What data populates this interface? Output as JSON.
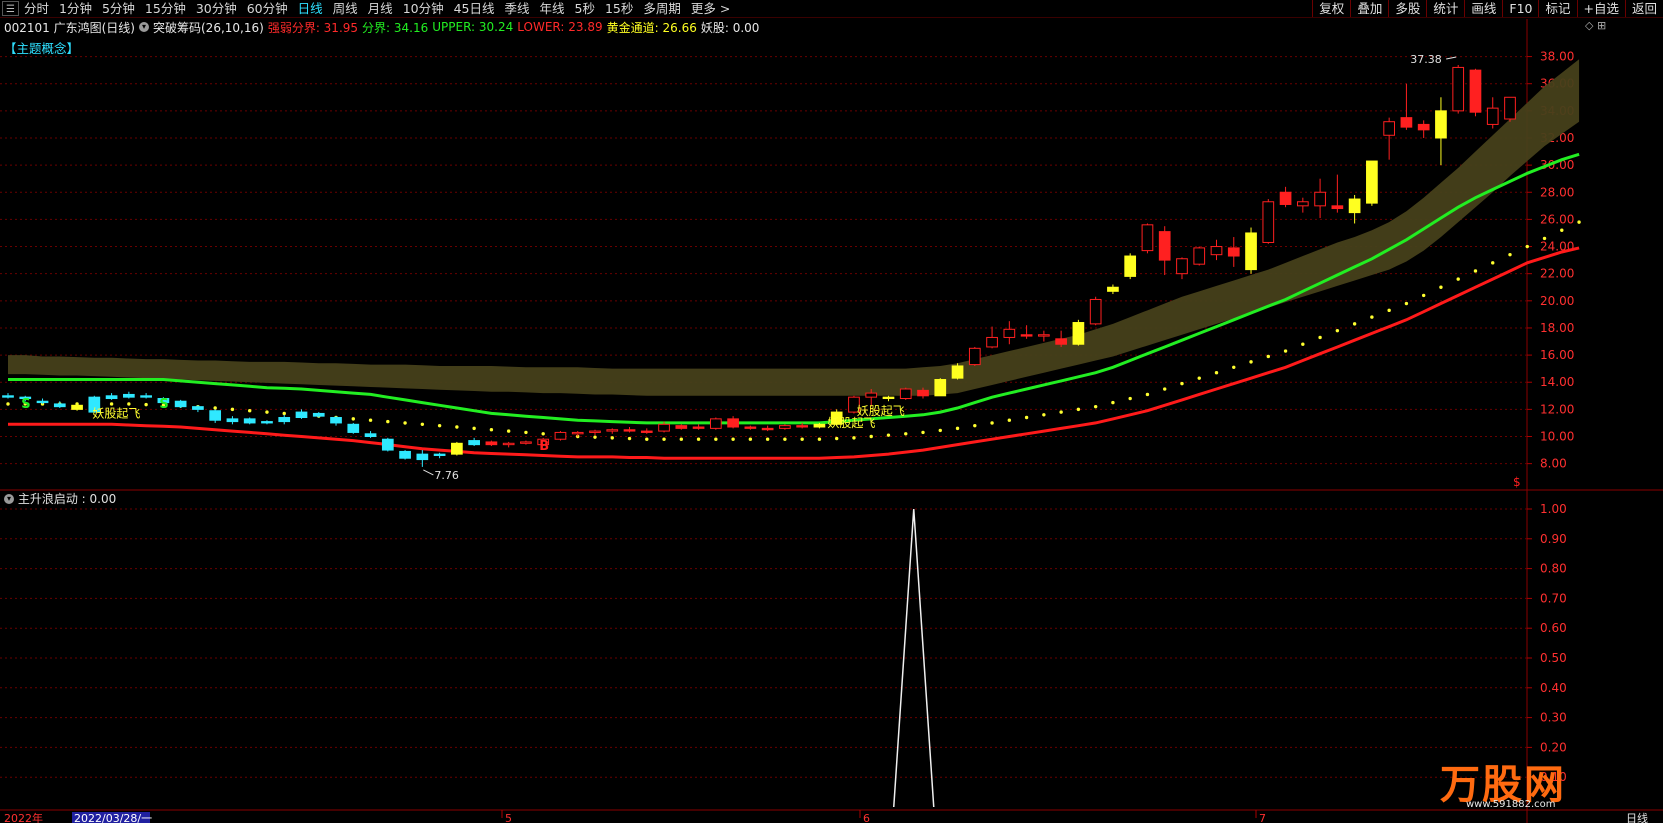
{
  "toolbar": {
    "menu_icon": "☰",
    "periods": [
      "分时",
      "1分钟",
      "5分钟",
      "15分钟",
      "30分钟",
      "60分钟",
      "日线",
      "周线",
      "月线",
      "10分钟",
      "45日线",
      "季线",
      "年线",
      "5秒",
      "15秒",
      "多周期",
      "更多 >"
    ],
    "active_period": "日线",
    "right_buttons": [
      "复权",
      "叠加",
      "多股",
      "统计",
      "画线",
      "F10",
      "标记",
      "+自选",
      "返回"
    ]
  },
  "info": {
    "code_name": "002101 广东鸿图(日线)",
    "indicator": "突破筹码(26,10,16)",
    "items": [
      {
        "label": "强弱分界: 31.95",
        "color": "#ff2a2a"
      },
      {
        "label": "分界: 34.16",
        "color": "#22ee22"
      },
      {
        "label": "UPPER: 30.24",
        "color": "#22ee22"
      },
      {
        "label": "LOWER: 23.89",
        "color": "#ff2a2a"
      },
      {
        "label": "黄金通道: 26.66",
        "color": "#ffff22"
      },
      {
        "label": "妖股: 0.00",
        "color": "#e8e8e8"
      }
    ]
  },
  "concept_label": "【主题概念】",
  "top_right_icons": "◇ ⊞",
  "main_axis": {
    "ticks": [
      "38.00",
      "36.00",
      "34.00",
      "32.00",
      "30.00",
      "28.00",
      "26.00",
      "24.00",
      "22.00",
      "20.00",
      "18.00",
      "16.00",
      "14.00",
      "12.00",
      "10.00",
      "8.00"
    ],
    "values": [
      38,
      36,
      34,
      32,
      30,
      28,
      26,
      24,
      22,
      20,
      18,
      16,
      14,
      12,
      10,
      8
    ],
    "ymin": 6.5,
    "ymax": 39
  },
  "sub_axis": {
    "ticks": [
      "1.00",
      "0.90",
      "0.80",
      "0.70",
      "0.60",
      "0.50",
      "0.40",
      "0.30",
      "0.20",
      "0.10"
    ],
    "values": [
      1,
      0.9,
      0.8,
      0.7,
      0.6,
      0.5,
      0.4,
      0.3,
      0.2,
      0.1
    ]
  },
  "sub_label": "主升浪启动 : 0.00",
  "annotations": {
    "high": "37.38",
    "low": "7.76",
    "signal1": "妖股起飞",
    "signal2": "妖股起飞",
    "signal3": "妖股起飞",
    "mark_s1": "S",
    "mark_s2": "S",
    "mark_b": "B",
    "mark_dollar": "$"
  },
  "dates": {
    "year": "2022年",
    "cursor": "2022/03/28/一",
    "m5": "5",
    "m6": "6",
    "m7": "7",
    "period": "日线"
  },
  "logo": {
    "text": "万股网",
    "url": "www.591882.com"
  },
  "chart_data": [
    {
      "type": "candlestick",
      "title": "",
      "candles": [
        [
          13.0,
          13.2,
          12.8,
          12.9
        ],
        [
          12.9,
          13.0,
          12.6,
          12.8
        ],
        [
          12.6,
          12.8,
          12.4,
          12.5
        ],
        [
          12.4,
          12.6,
          12.1,
          12.2
        ],
        [
          12.0,
          12.5,
          11.9,
          12.3
        ],
        [
          11.8,
          13.0,
          11.8,
          12.9
        ],
        [
          12.8,
          13.2,
          12.7,
          13.0
        ],
        [
          12.9,
          13.3,
          12.8,
          13.1
        ],
        [
          13.0,
          13.2,
          12.8,
          12.9
        ],
        [
          12.8,
          12.9,
          12.4,
          12.5
        ],
        [
          12.6,
          12.7,
          12.1,
          12.2
        ],
        [
          12.2,
          12.3,
          11.8,
          12.0
        ],
        [
          11.9,
          12.0,
          11.0,
          11.2
        ],
        [
          11.1,
          11.5,
          10.9,
          11.3
        ],
        [
          11.3,
          11.4,
          10.9,
          11.0
        ],
        [
          11.0,
          11.2,
          10.9,
          11.1
        ],
        [
          11.1,
          11.6,
          10.9,
          11.4
        ],
        [
          11.4,
          12.0,
          11.3,
          11.8
        ],
        [
          11.7,
          11.8,
          11.4,
          11.5
        ],
        [
          11.4,
          11.5,
          10.8,
          11.0
        ],
        [
          10.9,
          11.0,
          10.2,
          10.3
        ],
        [
          10.2,
          10.4,
          9.9,
          10.0
        ],
        [
          9.8,
          9.9,
          8.9,
          9.0
        ],
        [
          8.9,
          9.0,
          8.3,
          8.4
        ],
        [
          8.3,
          9.0,
          7.76,
          8.7
        ],
        [
          8.6,
          8.8,
          8.4,
          8.7
        ],
        [
          8.7,
          9.6,
          8.6,
          9.5
        ],
        [
          9.4,
          9.9,
          9.3,
          9.7
        ],
        [
          9.6,
          9.7,
          9.3,
          9.4
        ],
        [
          9.4,
          9.6,
          9.2,
          9.5
        ],
        [
          9.5,
          9.7,
          9.4,
          9.6
        ],
        [
          9.4,
          9.9,
          9.3,
          9.8
        ],
        [
          9.8,
          10.4,
          9.7,
          10.3
        ],
        [
          10.2,
          10.4,
          10.0,
          10.3
        ],
        [
          10.3,
          10.5,
          10.1,
          10.4
        ],
        [
          10.4,
          10.6,
          10.2,
          10.5
        ],
        [
          10.5,
          10.7,
          10.3,
          10.4
        ],
        [
          10.4,
          10.6,
          10.2,
          10.3
        ],
        [
          10.4,
          11.1,
          10.3,
          10.9
        ],
        [
          10.8,
          10.9,
          10.5,
          10.6
        ],
        [
          10.7,
          10.9,
          10.5,
          10.6
        ],
        [
          10.6,
          11.4,
          10.5,
          11.3
        ],
        [
          11.3,
          11.5,
          10.6,
          10.7
        ],
        [
          10.7,
          10.8,
          10.5,
          10.6
        ],
        [
          10.6,
          10.8,
          10.4,
          10.5
        ],
        [
          10.6,
          10.9,
          10.5,
          10.8
        ],
        [
          10.8,
          11.0,
          10.6,
          10.7
        ],
        [
          10.7,
          11.0,
          10.6,
          10.9
        ],
        [
          10.9,
          12.0,
          10.8,
          11.8
        ],
        [
          11.8,
          13.0,
          11.7,
          12.9
        ],
        [
          12.9,
          13.5,
          12.2,
          13.2
        ],
        [
          12.8,
          13.0,
          12.6,
          12.9
        ],
        [
          12.8,
          13.6,
          12.7,
          13.5
        ],
        [
          13.4,
          13.6,
          12.8,
          13.0
        ],
        [
          13.0,
          14.3,
          13.0,
          14.2
        ],
        [
          14.3,
          15.4,
          14.2,
          15.2
        ],
        [
          15.3,
          16.6,
          15.2,
          16.5
        ],
        [
          16.6,
          18.1,
          16.5,
          17.3
        ],
        [
          17.3,
          18.5,
          16.8,
          17.9
        ],
        [
          17.5,
          18.2,
          17.2,
          17.4
        ],
        [
          17.4,
          17.8,
          17.0,
          17.5
        ],
        [
          17.2,
          17.8,
          16.6,
          16.8
        ],
        [
          16.8,
          18.6,
          16.7,
          18.4
        ],
        [
          18.3,
          20.3,
          18.2,
          20.1
        ],
        [
          20.7,
          21.2,
          20.5,
          21.0
        ],
        [
          21.8,
          23.5,
          21.6,
          23.3
        ],
        [
          23.7,
          25.7,
          23.5,
          25.6
        ],
        [
          25.1,
          25.5,
          21.9,
          23.0
        ],
        [
          22.0,
          23.2,
          21.6,
          23.1
        ],
        [
          22.7,
          24.0,
          22.6,
          23.9
        ],
        [
          23.4,
          24.5,
          23.0,
          24.0
        ],
        [
          23.9,
          24.7,
          22.5,
          23.3
        ],
        [
          22.3,
          25.4,
          22.0,
          25.0
        ],
        [
          24.3,
          27.5,
          24.2,
          27.3
        ],
        [
          28.0,
          28.4,
          26.9,
          27.1
        ],
        [
          27.0,
          27.6,
          26.5,
          27.3
        ],
        [
          27.0,
          29.0,
          26.1,
          28.0
        ],
        [
          27.0,
          29.3,
          26.5,
          26.8
        ],
        [
          26.5,
          27.8,
          25.7,
          27.5
        ],
        [
          27.2,
          30.3,
          27.0,
          30.3
        ],
        [
          32.2,
          33.5,
          30.4,
          33.2
        ],
        [
          33.5,
          36.0,
          32.6,
          32.8
        ],
        [
          33.0,
          33.3,
          32.0,
          32.6
        ],
        [
          32.0,
          35.0,
          30.0,
          34.0
        ],
        [
          34.0,
          37.38,
          33.8,
          37.2
        ],
        [
          37.0,
          37.1,
          33.6,
          33.9
        ],
        [
          33.0,
          35.0,
          32.7,
          34.2
        ],
        [
          33.4,
          35.0,
          33.2,
          35.0
        ]
      ],
      "band_upper": [
        16.0,
        16.0,
        15.9,
        15.9,
        15.85,
        15.8,
        15.8,
        15.75,
        15.7,
        15.7,
        15.65,
        15.6,
        15.6,
        15.55,
        15.5,
        15.5,
        15.5,
        15.45,
        15.4,
        15.4,
        15.35,
        15.3,
        15.3,
        15.3,
        15.25,
        15.2,
        15.2,
        15.2,
        15.2,
        15.15,
        15.1,
        15.1,
        15.1,
        15.1,
        15.05,
        15.0,
        15.0,
        15.0,
        15.0,
        15.0,
        15.0,
        15.0,
        15.0,
        15.0,
        15.0,
        15.0,
        15.0,
        15.0,
        15.0,
        15.0,
        15.0,
        15.0,
        15.0,
        15.1,
        15.2,
        15.4,
        15.7,
        16.0,
        16.3,
        16.6,
        16.9,
        17.2,
        17.5,
        17.9,
        18.3,
        18.8,
        19.3,
        19.8,
        20.3,
        20.7,
        21.1,
        21.5,
        21.9,
        22.3,
        22.8,
        23.3,
        23.8,
        24.3,
        24.7,
        25.2,
        25.8,
        26.6,
        27.6,
        28.7,
        29.8,
        31.0,
        32.2,
        33.4,
        34.6,
        35.8,
        36.8,
        37.8
      ],
      "band_lower": [
        14.6,
        14.6,
        14.55,
        14.5,
        14.5,
        14.45,
        14.4,
        14.35,
        14.3,
        14.25,
        14.2,
        14.15,
        14.1,
        14.05,
        14.0,
        13.95,
        13.9,
        13.85,
        13.8,
        13.75,
        13.7,
        13.65,
        13.6,
        13.55,
        13.5,
        13.45,
        13.4,
        13.35,
        13.3,
        13.3,
        13.25,
        13.2,
        13.2,
        13.15,
        13.1,
        13.1,
        13.05,
        13.0,
        13.0,
        13.0,
        13.0,
        13.0,
        13.0,
        13.0,
        13.0,
        13.0,
        13.0,
        13.0,
        13.0,
        13.0,
        13.0,
        13.0,
        13.0,
        13.0,
        13.1,
        13.2,
        13.5,
        13.8,
        14.1,
        14.4,
        14.7,
        15.0,
        15.3,
        15.6,
        15.9,
        16.3,
        16.7,
        17.1,
        17.5,
        17.9,
        18.3,
        18.7,
        19.1,
        19.5,
        19.9,
        20.3,
        20.7,
        21.1,
        21.5,
        21.9,
        22.3,
        22.9,
        23.7,
        24.7,
        25.8,
        26.9,
        28.0,
        29.2,
        30.3,
        31.4,
        32.3,
        33.2
      ],
      "green_line": [
        14.2,
        14.2,
        14.2,
        14.2,
        14.2,
        14.2,
        14.2,
        14.2,
        14.2,
        14.2,
        14.1,
        14.0,
        13.9,
        13.8,
        13.7,
        13.6,
        13.55,
        13.5,
        13.4,
        13.3,
        13.2,
        13.1,
        12.9,
        12.7,
        12.5,
        12.3,
        12.1,
        11.9,
        11.7,
        11.6,
        11.5,
        11.4,
        11.3,
        11.2,
        11.15,
        11.1,
        11.05,
        11.0,
        11.0,
        11.0,
        11.0,
        11.0,
        11.0,
        11.0,
        11.0,
        11.0,
        11.0,
        11.0,
        11.1,
        11.2,
        11.3,
        11.4,
        11.5,
        11.6,
        11.8,
        12.1,
        12.5,
        12.9,
        13.2,
        13.5,
        13.8,
        14.1,
        14.4,
        14.7,
        15.1,
        15.6,
        16.1,
        16.6,
        17.1,
        17.6,
        18.1,
        18.6,
        19.1,
        19.6,
        20.1,
        20.7,
        21.3,
        21.9,
        22.5,
        23.1,
        23.8,
        24.5,
        25.3,
        26.1,
        26.9,
        27.6,
        28.2,
        28.8,
        29.4,
        29.9,
        30.4,
        30.8
      ],
      "dotted_line": [
        12.4,
        12.4,
        12.4,
        12.4,
        12.4,
        12.4,
        12.4,
        12.4,
        12.35,
        12.3,
        12.25,
        12.2,
        12.1,
        12.0,
        11.9,
        11.8,
        11.7,
        11.6,
        11.5,
        11.4,
        11.3,
        11.2,
        11.1,
        11.0,
        10.9,
        10.8,
        10.7,
        10.6,
        10.5,
        10.4,
        10.3,
        10.2,
        10.1,
        10.0,
        9.95,
        9.9,
        9.85,
        9.8,
        9.8,
        9.8,
        9.8,
        9.8,
        9.8,
        9.8,
        9.8,
        9.8,
        9.8,
        9.8,
        9.85,
        9.9,
        10.0,
        10.1,
        10.2,
        10.3,
        10.45,
        10.6,
        10.8,
        11.0,
        11.2,
        11.4,
        11.6,
        11.8,
        12.0,
        12.2,
        12.5,
        12.8,
        13.1,
        13.5,
        13.9,
        14.3,
        14.7,
        15.1,
        15.5,
        15.9,
        16.3,
        16.8,
        17.3,
        17.8,
        18.3,
        18.8,
        19.3,
        19.8,
        20.4,
        21.0,
        21.6,
        22.2,
        22.8,
        23.4,
        24.0,
        24.6,
        25.2,
        25.8
      ],
      "red_line": [
        10.9,
        10.9,
        10.9,
        10.9,
        10.9,
        10.9,
        10.9,
        10.85,
        10.8,
        10.75,
        10.7,
        10.6,
        10.5,
        10.4,
        10.3,
        10.2,
        10.1,
        10.0,
        9.9,
        9.8,
        9.7,
        9.55,
        9.4,
        9.25,
        9.1,
        9.0,
        8.9,
        8.8,
        8.75,
        8.7,
        8.65,
        8.6,
        8.55,
        8.5,
        8.5,
        8.5,
        8.45,
        8.45,
        8.4,
        8.4,
        8.4,
        8.4,
        8.4,
        8.4,
        8.4,
        8.4,
        8.4,
        8.4,
        8.45,
        8.5,
        8.6,
        8.7,
        8.85,
        9.0,
        9.2,
        9.4,
        9.6,
        9.8,
        10.0,
        10.2,
        10.4,
        10.6,
        10.8,
        11.0,
        11.3,
        11.6,
        11.9,
        12.3,
        12.7,
        13.1,
        13.5,
        13.9,
        14.3,
        14.7,
        15.1,
        15.6,
        16.1,
        16.6,
        17.1,
        17.6,
        18.1,
        18.6,
        19.2,
        19.8,
        20.4,
        21.0,
        21.6,
        22.2,
        22.8,
        23.2,
        23.6,
        23.9
      ]
    },
    {
      "type": "line",
      "title": "",
      "ylim": [
        0,
        1
      ],
      "peak_candle": 52,
      "peak_value": 1
    }
  ]
}
